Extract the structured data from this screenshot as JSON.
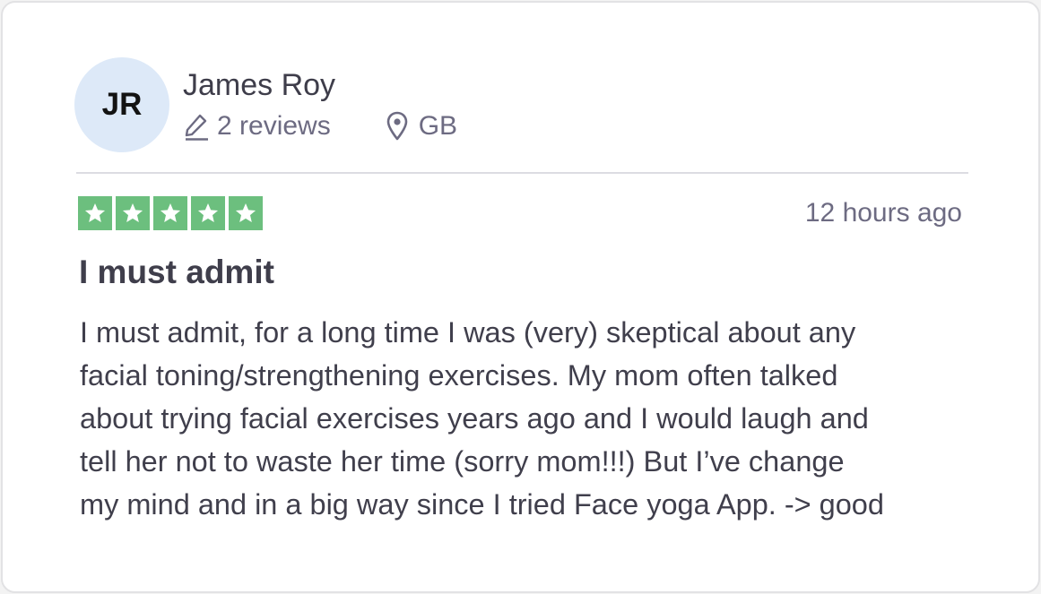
{
  "reviewer": {
    "initials": "JR",
    "name": "James Roy",
    "reviews_count": "2 reviews",
    "country": "GB"
  },
  "review": {
    "rating": 5,
    "rating_max": 5,
    "time_ago": "12 hours ago",
    "title": "I must admit",
    "body_lines": [
      "I must admit, for a long time I was (very) skeptical about any",
      "facial toning/strengthening exercises. My mom often talked",
      "about trying facial exercises years ago and I would laugh and",
      "tell her not to waste her time (sorry mom!!!) But I’ve change",
      "my mind and in a big way since I tried Face yoga App. -> good"
    ]
  },
  "icons": {
    "reviews": "pencil-icon",
    "location": "location-pin-icon",
    "star": "star-icon"
  },
  "colors": {
    "star_green": "#6cbf7e",
    "avatar_bg": "#dde9f8",
    "muted_text": "#6d6b82",
    "body_text": "#403f4c"
  }
}
